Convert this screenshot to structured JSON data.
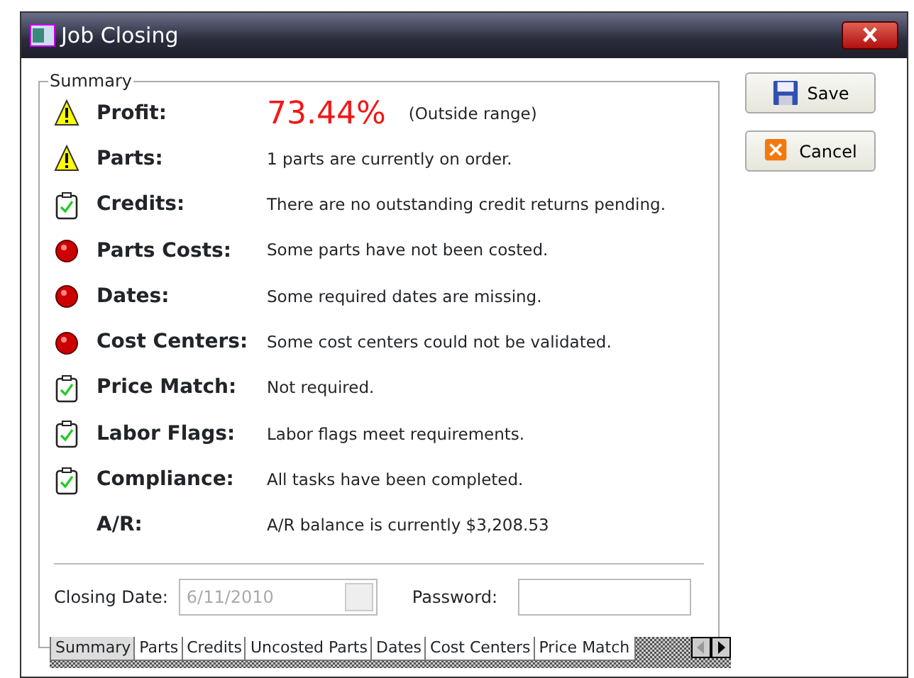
{
  "window": {
    "title": "Job Closing"
  },
  "summary": {
    "title": "Summary",
    "rows": [
      {
        "kind": "warning",
        "label": "Profit:",
        "value": "73.44%",
        "note": "(Outside range)"
      },
      {
        "kind": "warning",
        "label": "Parts:",
        "value": "1 parts are currently on order."
      },
      {
        "kind": "ok",
        "label": "Credits:",
        "value": "There are no outstanding credit returns pending."
      },
      {
        "kind": "error",
        "label": "Parts Costs:",
        "value": "Some parts have not been costed."
      },
      {
        "kind": "error",
        "label": "Dates:",
        "value": "Some required dates are missing."
      },
      {
        "kind": "error",
        "label": "Cost Centers:",
        "value": "Some cost centers could not be validated."
      },
      {
        "kind": "ok",
        "label": "Price Match:",
        "value": "Not required."
      },
      {
        "kind": "ok",
        "label": "Labor Flags:",
        "value": "Labor flags meet requirements."
      },
      {
        "kind": "ok",
        "label": "Compliance:",
        "value": "All tasks have been completed."
      },
      {
        "kind": "none",
        "label": "A/R:",
        "value": "A/R balance is currently $3,208.53"
      }
    ],
    "closing_date": {
      "label": "Closing Date:",
      "value": "6/11/2010",
      "disabled": true
    },
    "password": {
      "label": "Password:"
    }
  },
  "tabs": [
    {
      "label": "Summary",
      "selected": true
    },
    {
      "label": "Parts",
      "selected": false
    },
    {
      "label": "Credits",
      "selected": false
    },
    {
      "label": "Uncosted Parts",
      "selected": false
    },
    {
      "label": "Dates",
      "selected": false
    },
    {
      "label": "Cost Centers",
      "selected": false
    },
    {
      "label": "Price Match",
      "selected": false
    }
  ],
  "buttons": [
    {
      "kind": "save",
      "label": "Save"
    },
    {
      "kind": "cancel",
      "label": "Cancel"
    }
  ]
}
